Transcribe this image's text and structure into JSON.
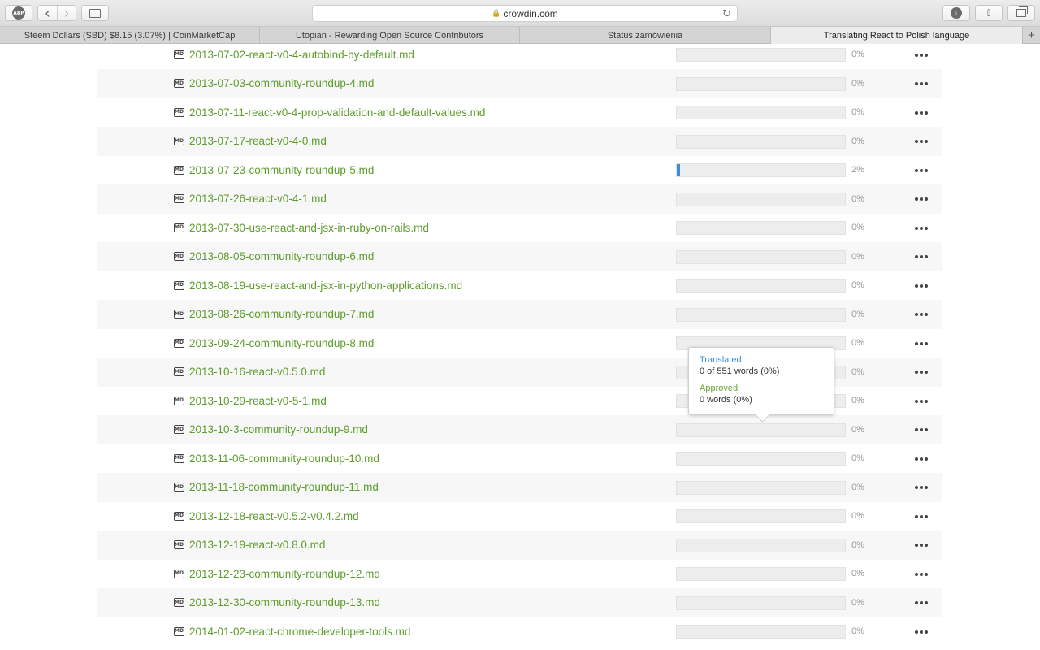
{
  "browser": {
    "address": "crowdin.com",
    "tabs": [
      {
        "label": "Steem Dollars (SBD) $8.15 (3.07%) | CoinMarketCap",
        "active": false
      },
      {
        "label": "Utopian - Rewarding Open Source Contributors",
        "active": false
      },
      {
        "label": "Status zamówienia",
        "active": false
      },
      {
        "label": "Translating React to Polish language",
        "active": true
      }
    ],
    "abp_label": "ABP",
    "back_glyph": "‹",
    "forward_glyph": "›",
    "reload_glyph": "↻",
    "lock_glyph": "🔒",
    "download_glyph": "↓",
    "share_glyph": "⇧",
    "new_tab_glyph": "+"
  },
  "file_icon_label": "MD",
  "files": [
    {
      "name": "2013-07-02-react-v0-4-autobind-by-default.md",
      "progress": 0,
      "percent_label": "0%"
    },
    {
      "name": "2013-07-03-community-roundup-4.md",
      "progress": 0,
      "percent_label": "0%"
    },
    {
      "name": "2013-07-11-react-v0-4-prop-validation-and-default-values.md",
      "progress": 0,
      "percent_label": "0%"
    },
    {
      "name": "2013-07-17-react-v0-4-0.md",
      "progress": 0,
      "percent_label": "0%"
    },
    {
      "name": "2013-07-23-community-roundup-5.md",
      "progress": 2,
      "percent_label": "2%"
    },
    {
      "name": "2013-07-26-react-v0-4-1.md",
      "progress": 0,
      "percent_label": "0%"
    },
    {
      "name": "2013-07-30-use-react-and-jsx-in-ruby-on-rails.md",
      "progress": 0,
      "percent_label": "0%"
    },
    {
      "name": "2013-08-05-community-roundup-6.md",
      "progress": 0,
      "percent_label": "0%"
    },
    {
      "name": "2013-08-19-use-react-and-jsx-in-python-applications.md",
      "progress": 0,
      "percent_label": "0%"
    },
    {
      "name": "2013-08-26-community-roundup-7.md",
      "progress": 0,
      "percent_label": "0%"
    },
    {
      "name": "2013-09-24-community-roundup-8.md",
      "progress": 0,
      "percent_label": "0%"
    },
    {
      "name": "2013-10-16-react-v0.5.0.md",
      "progress": 0,
      "percent_label": "0%"
    },
    {
      "name": "2013-10-29-react-v0-5-1.md",
      "progress": 0,
      "percent_label": "0%"
    },
    {
      "name": "2013-10-3-community-roundup-9.md",
      "progress": 0,
      "percent_label": "0%"
    },
    {
      "name": "2013-11-06-community-roundup-10.md",
      "progress": 0,
      "percent_label": "0%"
    },
    {
      "name": "2013-11-18-community-roundup-11.md",
      "progress": 0,
      "percent_label": "0%"
    },
    {
      "name": "2013-12-18-react-v0.5.2-v0.4.2.md",
      "progress": 0,
      "percent_label": "0%"
    },
    {
      "name": "2013-12-19-react-v0.8.0.md",
      "progress": 0,
      "percent_label": "0%"
    },
    {
      "name": "2013-12-23-community-roundup-12.md",
      "progress": 0,
      "percent_label": "0%"
    },
    {
      "name": "2013-12-30-community-roundup-13.md",
      "progress": 0,
      "percent_label": "0%"
    },
    {
      "name": "2014-01-02-react-chrome-developer-tools.md",
      "progress": 0,
      "percent_label": "0%"
    }
  ],
  "tooltip": {
    "translated_label": "Translated:",
    "translated_value": "0 of 551 words (0%)",
    "approved_label": "Approved:",
    "approved_value": "0 words (0%)"
  },
  "colors": {
    "link": "#5e9d2d",
    "progress_fill": "#3b8fd9",
    "translated": "#3b8fd9",
    "approved": "#6aa535"
  }
}
